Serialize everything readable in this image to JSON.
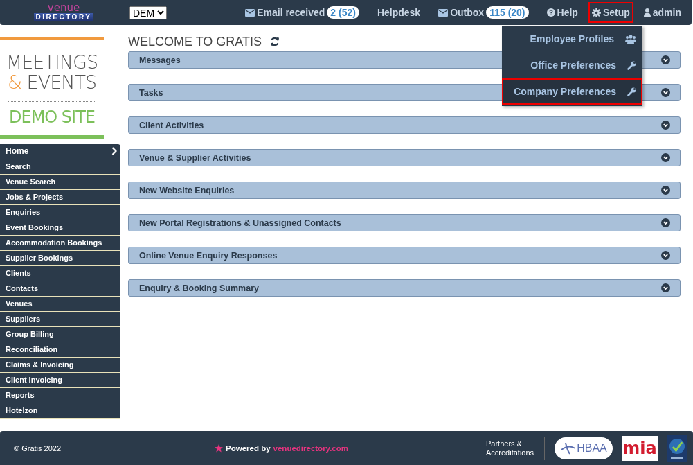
{
  "topbar": {
    "logo": {
      "top": "venue",
      "bottom": "DIRECTORY"
    },
    "office_select": {
      "value": "DEM"
    },
    "links": [
      {
        "kind": "mail",
        "label": "Email received",
        "badge": "2 (52)",
        "selected": false
      },
      {
        "kind": "plain",
        "label": "Helpdesk",
        "selected": false
      },
      {
        "kind": "mail",
        "label": "Outbox",
        "badge": "115 (20)",
        "selected": false
      },
      {
        "kind": "help",
        "label": "Help",
        "selected": false
      },
      {
        "kind": "setup",
        "label": "Setup",
        "selected": true
      },
      {
        "kind": "user",
        "label": "admin",
        "selected": false
      }
    ]
  },
  "setup_menu": [
    {
      "label": "Employee Profiles",
      "kind": "people",
      "selected": false
    },
    {
      "label": "Office Preferences",
      "kind": "tool",
      "selected": false
    },
    {
      "label": "Company Preferences",
      "kind": "tool",
      "selected": true
    }
  ],
  "site_logo": {
    "line_1": "MEETINGS",
    "ampersand": "&",
    "line_2": "EVENTS",
    "subtitle": "DEMO SITE"
  },
  "sidebar": {
    "items": [
      {
        "label": "Home",
        "selected": true
      },
      {
        "label": "Search",
        "selected": false
      },
      {
        "label": "Venue Search",
        "selected": false
      },
      {
        "label": "Jobs & Projects",
        "selected": false
      },
      {
        "label": "Enquiries",
        "selected": false
      },
      {
        "label": "Event Bookings",
        "selected": false
      },
      {
        "label": "Accommodation Bookings",
        "selected": false
      },
      {
        "label": "Supplier Bookings",
        "selected": false
      },
      {
        "label": "Clients",
        "selected": false
      },
      {
        "label": "Contacts",
        "selected": false
      },
      {
        "label": "Venues",
        "selected": false
      },
      {
        "label": "Suppliers",
        "selected": false
      },
      {
        "label": "Group Billing",
        "selected": false
      },
      {
        "label": "Reconciliation",
        "selected": false
      },
      {
        "label": "Claims & Invoicing",
        "selected": false
      },
      {
        "label": "Client Invoicing",
        "selected": false
      },
      {
        "label": "Reports",
        "selected": false
      },
      {
        "label": "Hotelzon",
        "selected": false
      }
    ]
  },
  "main": {
    "title": "WELCOME TO GRATIS",
    "panels": [
      {
        "title": "Messages",
        "expanded": false
      },
      {
        "title": "Tasks",
        "expanded": false
      },
      {
        "title": "Client Activities",
        "expanded": false
      },
      {
        "title": "Venue & Supplier Activities",
        "expanded": false
      },
      {
        "title": "New Website Enquiries",
        "expanded": false
      },
      {
        "title": "New Portal Registrations & Unassigned Contacts",
        "expanded": false
      },
      {
        "title": "Online Venue Enquiry Responses",
        "expanded": false
      },
      {
        "title": "Enquiry & Booking Summary",
        "expanded": false
      }
    ]
  },
  "footer": {
    "copyright": "© Gratis 2022",
    "powered_by": "Powered by",
    "powered_link": "venuedirectory.com",
    "partners": "Partners & Accreditations",
    "partner_logos": [
      "HBAA",
      "mia"
    ]
  }
}
